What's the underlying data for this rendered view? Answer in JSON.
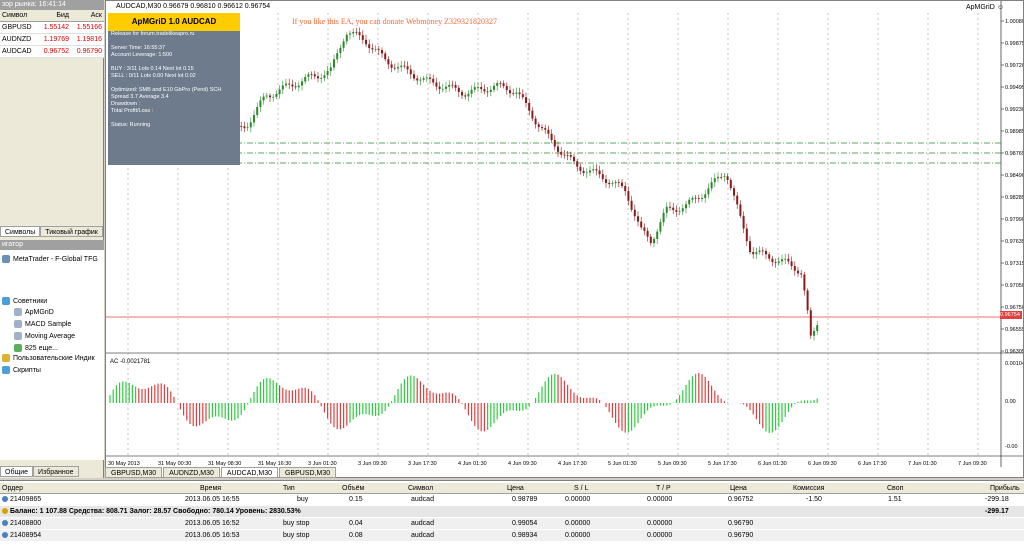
{
  "market_watch": {
    "title": "зор рынка: 16:41:14",
    "headers": [
      "Символ",
      "Бид",
      "Аск"
    ],
    "rows": [
      {
        "symbol": "GBPUSD",
        "bid": "1.55142",
        "ask": "1.55166"
      },
      {
        "symbol": "AUDNZD",
        "bid": "1.19769",
        "ask": "1.19816"
      },
      {
        "symbol": "AUDCAD",
        "bid": "0.96752",
        "ask": "0.96790"
      }
    ],
    "tabs": [
      "Символы",
      "Тиковый график"
    ]
  },
  "navigator": {
    "title": "игатор",
    "items": [
      "MetaTrader - F-Global TFG",
      "Советники",
      "ApMGriD",
      "MACD Sample",
      "Moving Average",
      "825 еще...",
      "Пользовательские Индик",
      "Скрипты"
    ],
    "tabs": [
      "Общие",
      "Избранное"
    ]
  },
  "chart": {
    "header": "AUDCAD,M30  0.96679 0.96810 0.96612 0.96754",
    "ea_label": "ApMGriD",
    "donate": "If you like this EA, you can donate Webmoney Z329321820327",
    "indicator_label": "AC -0.0021781",
    "price_labels": [
      "1.00080",
      "0.99875",
      "0.99720",
      "0.99495",
      "0.99230",
      "0.98985",
      "0.98765",
      "0.98490",
      "0.98285",
      "0.97990",
      "0.97635",
      "0.97315",
      "0.97050",
      "0.96750",
      "0.96555",
      "0.96305"
    ],
    "current_price": "0.96754",
    "ac_scale": [
      "0.00104",
      "0.00",
      "-0.00"
    ],
    "time_labels": [
      "30 May 2013",
      "31 May 00:30",
      "31 May 08:30",
      "31 May 16:30",
      "3 Jun 01:30",
      "3 Jun 09:30",
      "3 Jun 17:30",
      "4 Jun 01:30",
      "4 Jun 09:30",
      "4 Jun 17:30",
      "5 Jun 01:30",
      "5 Jun 09:30",
      "5 Jun 17:30",
      "6 Jun 01:30",
      "6 Jun 09:30",
      "6 Jun 17:30",
      "7 Jun 01:30",
      "7 Jun 09:30"
    ],
    "tabs": [
      "GBPUSD,M30",
      "AUDNZD,M30",
      "AUDCAD,M30",
      "GBPUSD,M30"
    ]
  },
  "panel": {
    "title": "ApMGriD 1.0 AUDCAD",
    "lines": [
      "Release for forum.tradelikeapro.ru",
      "",
      "Server Time:                 16:55:37",
      "Account Leverage:             1:500",
      "",
      "BUY : 3/11  Lots 0.14 Next lot 0.15",
      "SELL : 0/11  Lots 0.00 Next lot 0.02",
      "",
      "Optimized: SMB and E10 GbPro (Pend) SCH",
      "Spread 3.7 Average 3.4",
      "Drawdown :",
      "Total Profit/Loss :",
      "",
      "Status: Running"
    ]
  },
  "terminal": {
    "headers": [
      "Ордер",
      "Время",
      "Тип",
      "Объём",
      "Символ",
      "Цена",
      "S / L",
      "T / P",
      "Цена",
      "Комиссия",
      "Своп",
      "Прибыль"
    ],
    "rows": [
      {
        "order": "21409865",
        "time": "2013.06.05 16:55",
        "type": "buy",
        "volume": "0.15",
        "symbol": "audcad",
        "price": "0.98789",
        "sl": "0.00000",
        "tp": "0.00000",
        "cur": "0.96752",
        "comm": "-1.50",
        "swap": "1.51",
        "profit": "-299.18"
      }
    ],
    "balance_line": "Баланс: 1 107.88  Средства: 808.71  Залог: 28.57  Свободно: 780.14  Уровень: 2830.53%",
    "balance_profit": "-299.17",
    "pending": [
      {
        "order": "21408800",
        "time": "2013.06.05 16:52",
        "type": "buy stop",
        "volume": "0.04",
        "symbol": "audcad",
        "price": "0.99054",
        "sl": "0.00000",
        "tp": "0.00000",
        "cur": "0.96790"
      },
      {
        "order": "21408954",
        "time": "2013.06.05 16:53",
        "type": "buy stop",
        "volume": "0.08",
        "symbol": "audcad",
        "price": "0.98934",
        "sl": "0.00000",
        "tp": "0.00000",
        "cur": "0.96790"
      }
    ]
  },
  "colors": {
    "bull": "#2a8a2a",
    "bear": "#8b1a1a",
    "ac_up": "#2ecc40",
    "ac_down": "#e04040",
    "panel": "#6d7b8d",
    "title_bg": "#ffcc00"
  }
}
